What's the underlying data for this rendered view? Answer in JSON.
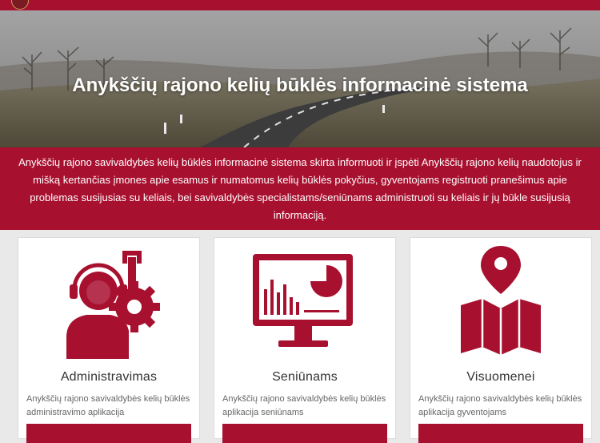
{
  "colors": {
    "accent": "#a8102f",
    "banner": "#a8102f",
    "card_bg": "#ffffff",
    "page_bg": "#e9e9e9"
  },
  "header": {
    "logo": "municipality-crest-icon"
  },
  "hero": {
    "title": "Anykščių rajono kelių būklės informacinė sistema",
    "background": "winding-road-photo"
  },
  "banner": {
    "text": "Anykščių rajono savivaldybės kelių būklės informacinė sistema skirta informuoti ir įspėti Anykščių rajono kelių naudotojus ir mišką kertančias įmones apie esamus ir numatomus kelių būklės pokyčius, gyventojams registruoti pranešimus apie problemas susijusias su keliais, bei savivaldybės specialistams/seniūnams administruoti su keliais ir jų būkle susijusią informaciją."
  },
  "cards": [
    {
      "icon": "support-operator-gear-icon",
      "title": "Administravimas",
      "description": "Anykščių rajono savivaldybės kelių būklės administravimo aplikacija"
    },
    {
      "icon": "monitor-chart-icon",
      "title": "Seniūnams",
      "description": "Anykščių rajono savivaldybės kelių būklės aplikacija seniūnams"
    },
    {
      "icon": "map-pin-icon",
      "title": "Visuomenei",
      "description": "Anykščių rajono savivaldybės kelių būklės aplikacija gyventojams"
    }
  ]
}
